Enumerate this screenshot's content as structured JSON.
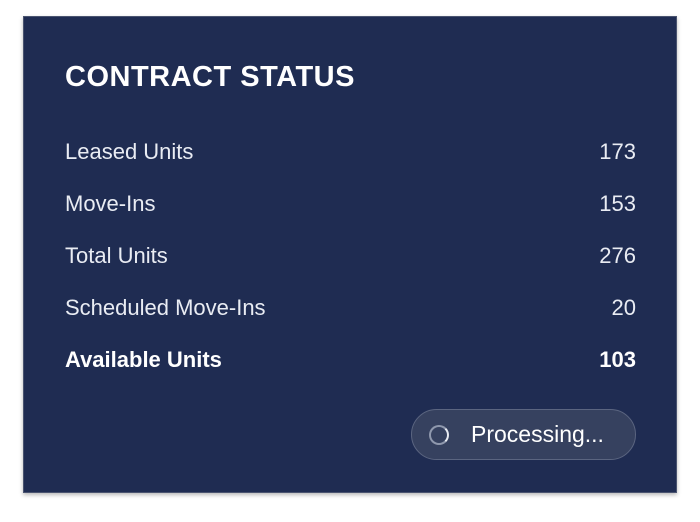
{
  "panel": {
    "title": "CONTRACT STATUS",
    "rows": [
      {
        "label": "Leased Units",
        "value": "173"
      },
      {
        "label": "Move-Ins",
        "value": "153"
      },
      {
        "label": "Total Units",
        "value": "276"
      },
      {
        "label": "Scheduled Move-Ins",
        "value": "20"
      },
      {
        "label": "Available Units",
        "value": "103"
      }
    ],
    "status_text": "Processing...",
    "status_icon": "spinner-icon"
  },
  "colors": {
    "card_background": "#1f2c52",
    "text": "#ffffff",
    "status_pill_background": "#36415f"
  }
}
